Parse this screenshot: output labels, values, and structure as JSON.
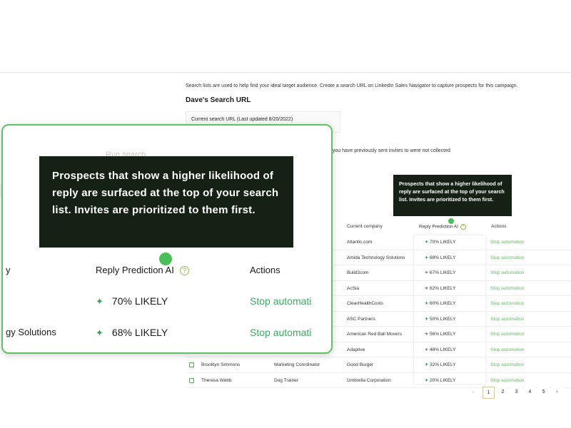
{
  "app": {
    "intro": "Search lists are used to help find your ideal target audience. Create a search URL on LinkedIn Sales Navigator to capture prospects for this campaign.",
    "title": "Dave's Search URL",
    "search_label": "Current search URL (Last updated 8/20/2022)",
    "run_search": "Run search",
    "note": "t you have previously sent invites to were not collected"
  },
  "table": {
    "headers": {
      "company": "Current company",
      "reply": "Reply Prediction AI",
      "actions": "Actions"
    },
    "rows": [
      {
        "name": "",
        "title": "",
        "company": "Atlantic.com",
        "reply": "70% LIKELY",
        "action": "Stop automation"
      },
      {
        "name": "",
        "title": "",
        "company": "Amida Technology Solutions",
        "reply": "68% LIKELY",
        "action": "Stop automation"
      },
      {
        "name": "",
        "title": "",
        "company": "Build2com",
        "reply": "67% LIKELY",
        "action": "Stop automation"
      },
      {
        "name": "",
        "title": "",
        "company": "AcSia",
        "reply": "62% LIKELY",
        "action": "Stop automation"
      },
      {
        "name": "",
        "title": "",
        "company": "ClearHealthCosts",
        "reply": "60% LIKELY",
        "action": "Stop automation"
      },
      {
        "name": "",
        "title": "",
        "company": "ASC Partners",
        "reply": "50% LIKELY",
        "action": "Stop automation"
      },
      {
        "name": "",
        "title": "",
        "company": "American Red Ball Movers",
        "reply": "56% LIKELY",
        "action": "Stop automation"
      },
      {
        "name": "",
        "title": "",
        "company": "Adaptive",
        "reply": "48% LIKELY",
        "action": "Stop automation"
      },
      {
        "name": "Brooklyn Simmons",
        "title": "Marketing Coordinator",
        "company": "Good Burger",
        "reply": "32% LIKELY",
        "action": "Stop automation"
      },
      {
        "name": "Theresa Webb",
        "title": "Dog Trainer",
        "company": "Umbrella Corporation",
        "reply": "20% LIKELY",
        "action": "Stop automation"
      }
    ]
  },
  "pagination": {
    "prev": "‹",
    "pages": [
      "1",
      "2",
      "3",
      "4",
      "5"
    ],
    "next": "›",
    "active": "1"
  },
  "tooltip": {
    "text": "Prospects that show a higher likelihood of reply are surfaced at the top of your search list. Invites are prioritized to them first."
  },
  "zoom": {
    "col1_header": "y",
    "col2_header": "Reply Prediction AI",
    "col3_header": "Actions",
    "rows": [
      {
        "left": "",
        "reply": "70% LIKELY",
        "action": "Stop automati"
      },
      {
        "left": "gy Solutions",
        "reply": "68% LIKELY",
        "action": "Stop automati"
      }
    ]
  },
  "icons": {
    "help": "question-circle-icon",
    "sparkle": "sparkle-icon",
    "checkbox": "checkbox-icon"
  },
  "colors": {
    "accent_green": "#3eaa62",
    "tooltip_bg": "#142114",
    "callout_border": "#5dc464"
  }
}
